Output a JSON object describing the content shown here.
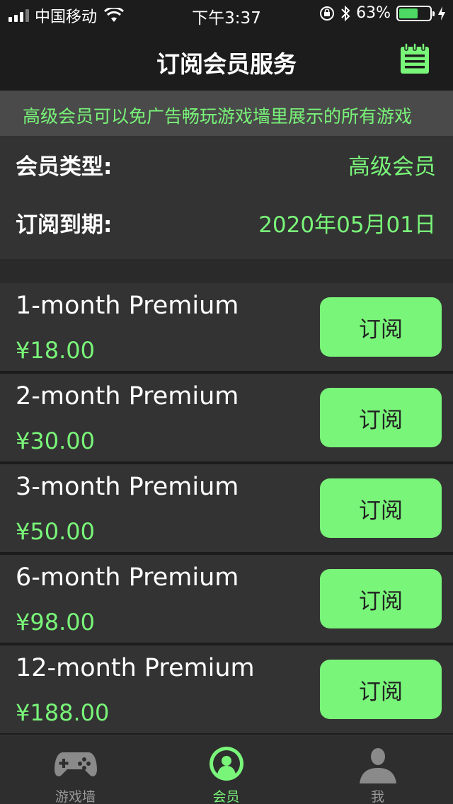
{
  "status_bar": {
    "carrier": "中国移动",
    "time": "下午3:37",
    "battery_percent": "63%",
    "battery_level": 0.63,
    "signal_bars": 3,
    "icons": [
      "signal-icon",
      "wifi-icon",
      "orientation-lock-icon",
      "bluetooth-icon",
      "battery-icon",
      "charging-icon"
    ]
  },
  "nav": {
    "title": "订阅会员服务",
    "right_icon": "notes-icon"
  },
  "marquee": {
    "text": "高级会员可以免广告畅玩游戏墙里展示的所有游戏"
  },
  "member_info": {
    "type_label": "会员类型:",
    "type_value": "高级会员",
    "expiry_label": "订阅到期:",
    "expiry_value": "2020年05月01日"
  },
  "plans": [
    {
      "name": "1-month Premium",
      "price": "¥18.00",
      "button": "订阅"
    },
    {
      "name": "2-month Premium",
      "price": "¥30.00",
      "button": "订阅"
    },
    {
      "name": "3-month Premium",
      "price": "¥50.00",
      "button": "订阅"
    },
    {
      "name": "6-month Premium",
      "price": "¥98.00",
      "button": "订阅"
    },
    {
      "name": "12-month Premium",
      "price": "¥188.00",
      "button": "订阅"
    }
  ],
  "tabbar": {
    "tabs": [
      {
        "label": "游戏墙",
        "icon": "gamepad-icon",
        "active": false
      },
      {
        "label": "会员",
        "icon": "member-icon",
        "active": true
      },
      {
        "label": "我",
        "icon": "profile-icon",
        "active": false
      }
    ]
  },
  "colors": {
    "accent": "#79f579",
    "background": "#1c1c1c",
    "row_background": "#333333",
    "marquee_background": "#4a4a4a",
    "inactive_tab": "#9a9a9a"
  }
}
